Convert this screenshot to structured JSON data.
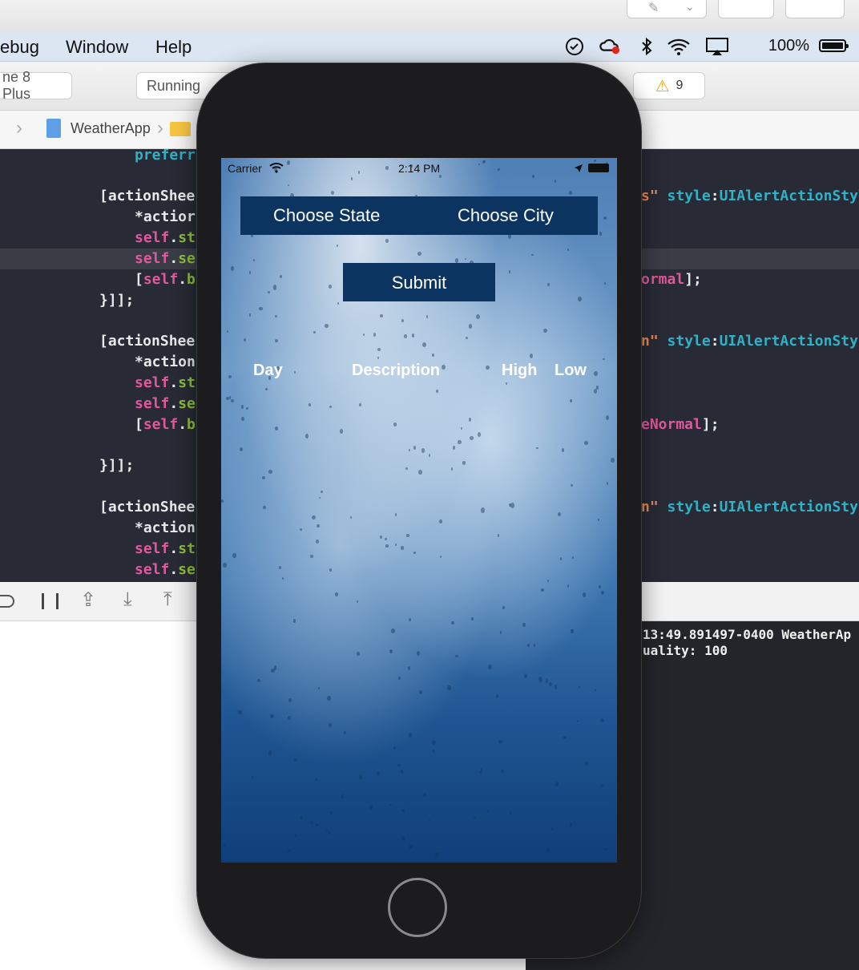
{
  "menubar": {
    "items": [
      "ebug",
      "Window",
      "Help"
    ],
    "battery_percent": "100%"
  },
  "xcode_toolbar": {
    "scheme_device": "ne 8 Plus",
    "status": "Running",
    "warning_count": "9"
  },
  "jumpbar": {
    "project": "WeatherApp"
  },
  "console": {
    "line1": "13:49.891497-0400 WeatherAp",
    "line2": "uality: 100"
  },
  "simulator": {
    "status_bar": {
      "carrier": "Carrier",
      "time": "2:14 PM"
    },
    "choose_state_label": "Choose State",
    "choose_city_label": "Choose City",
    "submit_label": "Submit",
    "table_headers": {
      "day": "Day",
      "description": "Description",
      "high": "High",
      "low": "Low"
    }
  },
  "colors": {
    "navy_button": "#0c3461",
    "editor_bg": "#282b35",
    "keyword": "#e0589d",
    "type": "#2fb1c6"
  }
}
